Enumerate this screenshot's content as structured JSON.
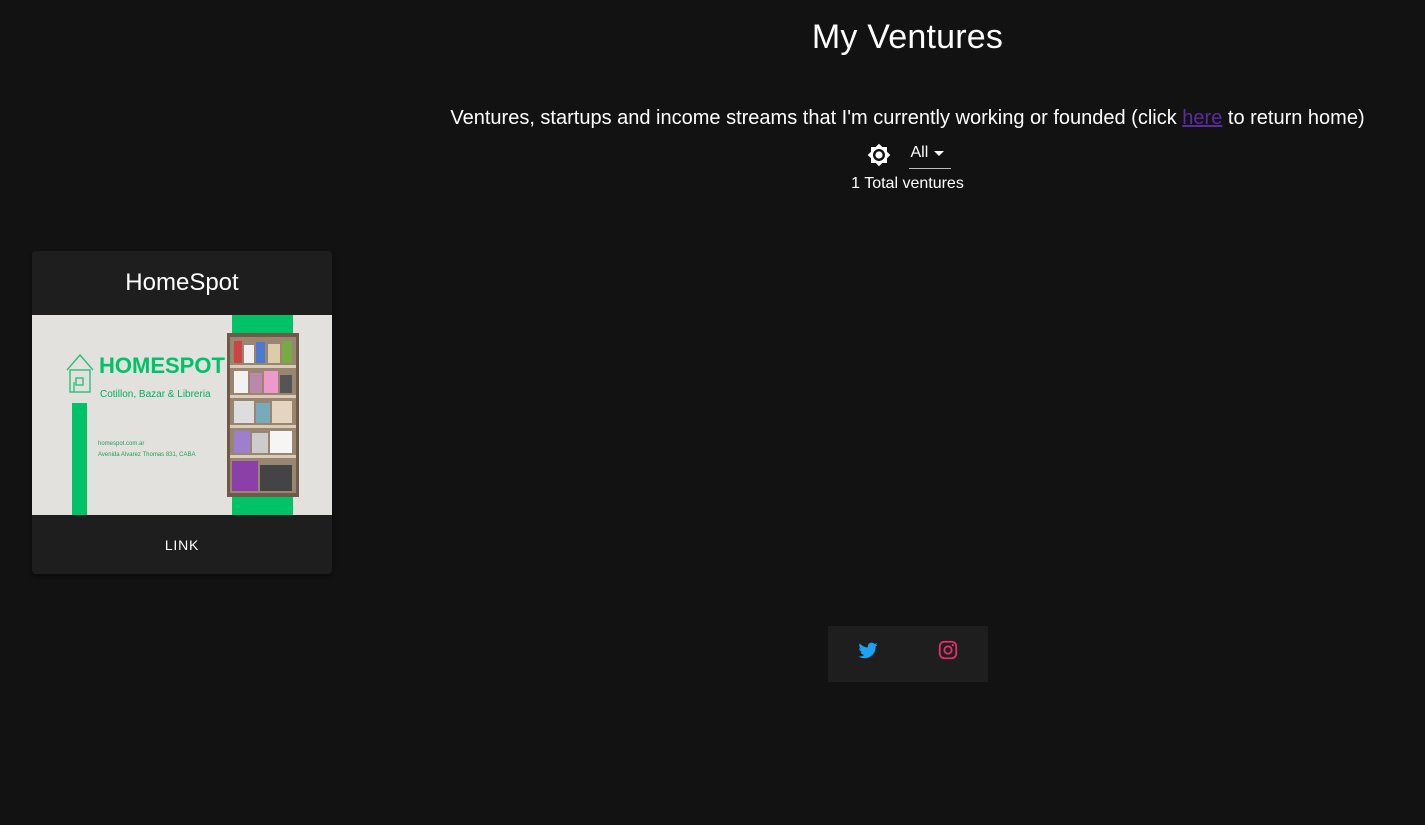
{
  "page": {
    "title": "My Ventures",
    "subtitle_before": "Ventures, startups and income streams that I'm currently working or founded (click ",
    "subtitle_link": "here",
    "subtitle_after": " to return home)"
  },
  "filter": {
    "selected": "All"
  },
  "summary": {
    "total_text": "1 Total ventures"
  },
  "ventures": [
    {
      "title": "HomeSpot",
      "image": {
        "brand": "HOMESPOT",
        "tagline": "Cotillon, Bazar & Libreria",
        "website": "homespot.com.ar",
        "address": "Avenida Alvarez Thomas 831, CABA",
        "brand_color": "#00c266"
      },
      "action_label": "LINK"
    }
  ],
  "social": {
    "twitter_color": "#1da1f2",
    "instagram_color": "#e1306c"
  },
  "colors": {
    "background": "#121212",
    "surface": "#1e1e1e",
    "link": "#5b2ca0"
  }
}
